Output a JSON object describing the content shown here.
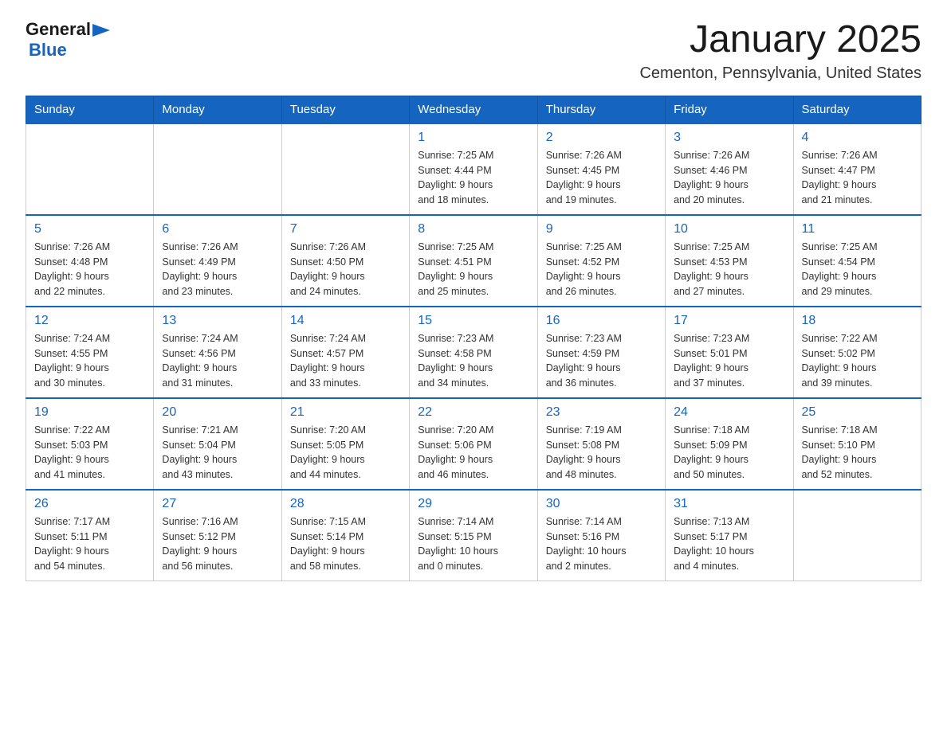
{
  "header": {
    "logo_general": "General",
    "logo_blue": "Blue",
    "month_title": "January 2025",
    "location": "Cementon, Pennsylvania, United States"
  },
  "days_of_week": [
    "Sunday",
    "Monday",
    "Tuesday",
    "Wednesday",
    "Thursday",
    "Friday",
    "Saturday"
  ],
  "weeks": [
    [
      {
        "day": "",
        "info": ""
      },
      {
        "day": "",
        "info": ""
      },
      {
        "day": "",
        "info": ""
      },
      {
        "day": "1",
        "info": "Sunrise: 7:25 AM\nSunset: 4:44 PM\nDaylight: 9 hours\nand 18 minutes."
      },
      {
        "day": "2",
        "info": "Sunrise: 7:26 AM\nSunset: 4:45 PM\nDaylight: 9 hours\nand 19 minutes."
      },
      {
        "day": "3",
        "info": "Sunrise: 7:26 AM\nSunset: 4:46 PM\nDaylight: 9 hours\nand 20 minutes."
      },
      {
        "day": "4",
        "info": "Sunrise: 7:26 AM\nSunset: 4:47 PM\nDaylight: 9 hours\nand 21 minutes."
      }
    ],
    [
      {
        "day": "5",
        "info": "Sunrise: 7:26 AM\nSunset: 4:48 PM\nDaylight: 9 hours\nand 22 minutes."
      },
      {
        "day": "6",
        "info": "Sunrise: 7:26 AM\nSunset: 4:49 PM\nDaylight: 9 hours\nand 23 minutes."
      },
      {
        "day": "7",
        "info": "Sunrise: 7:26 AM\nSunset: 4:50 PM\nDaylight: 9 hours\nand 24 minutes."
      },
      {
        "day": "8",
        "info": "Sunrise: 7:25 AM\nSunset: 4:51 PM\nDaylight: 9 hours\nand 25 minutes."
      },
      {
        "day": "9",
        "info": "Sunrise: 7:25 AM\nSunset: 4:52 PM\nDaylight: 9 hours\nand 26 minutes."
      },
      {
        "day": "10",
        "info": "Sunrise: 7:25 AM\nSunset: 4:53 PM\nDaylight: 9 hours\nand 27 minutes."
      },
      {
        "day": "11",
        "info": "Sunrise: 7:25 AM\nSunset: 4:54 PM\nDaylight: 9 hours\nand 29 minutes."
      }
    ],
    [
      {
        "day": "12",
        "info": "Sunrise: 7:24 AM\nSunset: 4:55 PM\nDaylight: 9 hours\nand 30 minutes."
      },
      {
        "day": "13",
        "info": "Sunrise: 7:24 AM\nSunset: 4:56 PM\nDaylight: 9 hours\nand 31 minutes."
      },
      {
        "day": "14",
        "info": "Sunrise: 7:24 AM\nSunset: 4:57 PM\nDaylight: 9 hours\nand 33 minutes."
      },
      {
        "day": "15",
        "info": "Sunrise: 7:23 AM\nSunset: 4:58 PM\nDaylight: 9 hours\nand 34 minutes."
      },
      {
        "day": "16",
        "info": "Sunrise: 7:23 AM\nSunset: 4:59 PM\nDaylight: 9 hours\nand 36 minutes."
      },
      {
        "day": "17",
        "info": "Sunrise: 7:23 AM\nSunset: 5:01 PM\nDaylight: 9 hours\nand 37 minutes."
      },
      {
        "day": "18",
        "info": "Sunrise: 7:22 AM\nSunset: 5:02 PM\nDaylight: 9 hours\nand 39 minutes."
      }
    ],
    [
      {
        "day": "19",
        "info": "Sunrise: 7:22 AM\nSunset: 5:03 PM\nDaylight: 9 hours\nand 41 minutes."
      },
      {
        "day": "20",
        "info": "Sunrise: 7:21 AM\nSunset: 5:04 PM\nDaylight: 9 hours\nand 43 minutes."
      },
      {
        "day": "21",
        "info": "Sunrise: 7:20 AM\nSunset: 5:05 PM\nDaylight: 9 hours\nand 44 minutes."
      },
      {
        "day": "22",
        "info": "Sunrise: 7:20 AM\nSunset: 5:06 PM\nDaylight: 9 hours\nand 46 minutes."
      },
      {
        "day": "23",
        "info": "Sunrise: 7:19 AM\nSunset: 5:08 PM\nDaylight: 9 hours\nand 48 minutes."
      },
      {
        "day": "24",
        "info": "Sunrise: 7:18 AM\nSunset: 5:09 PM\nDaylight: 9 hours\nand 50 minutes."
      },
      {
        "day": "25",
        "info": "Sunrise: 7:18 AM\nSunset: 5:10 PM\nDaylight: 9 hours\nand 52 minutes."
      }
    ],
    [
      {
        "day": "26",
        "info": "Sunrise: 7:17 AM\nSunset: 5:11 PM\nDaylight: 9 hours\nand 54 minutes."
      },
      {
        "day": "27",
        "info": "Sunrise: 7:16 AM\nSunset: 5:12 PM\nDaylight: 9 hours\nand 56 minutes."
      },
      {
        "day": "28",
        "info": "Sunrise: 7:15 AM\nSunset: 5:14 PM\nDaylight: 9 hours\nand 58 minutes."
      },
      {
        "day": "29",
        "info": "Sunrise: 7:14 AM\nSunset: 5:15 PM\nDaylight: 10 hours\nand 0 minutes."
      },
      {
        "day": "30",
        "info": "Sunrise: 7:14 AM\nSunset: 5:16 PM\nDaylight: 10 hours\nand 2 minutes."
      },
      {
        "day": "31",
        "info": "Sunrise: 7:13 AM\nSunset: 5:17 PM\nDaylight: 10 hours\nand 4 minutes."
      },
      {
        "day": "",
        "info": ""
      }
    ]
  ]
}
